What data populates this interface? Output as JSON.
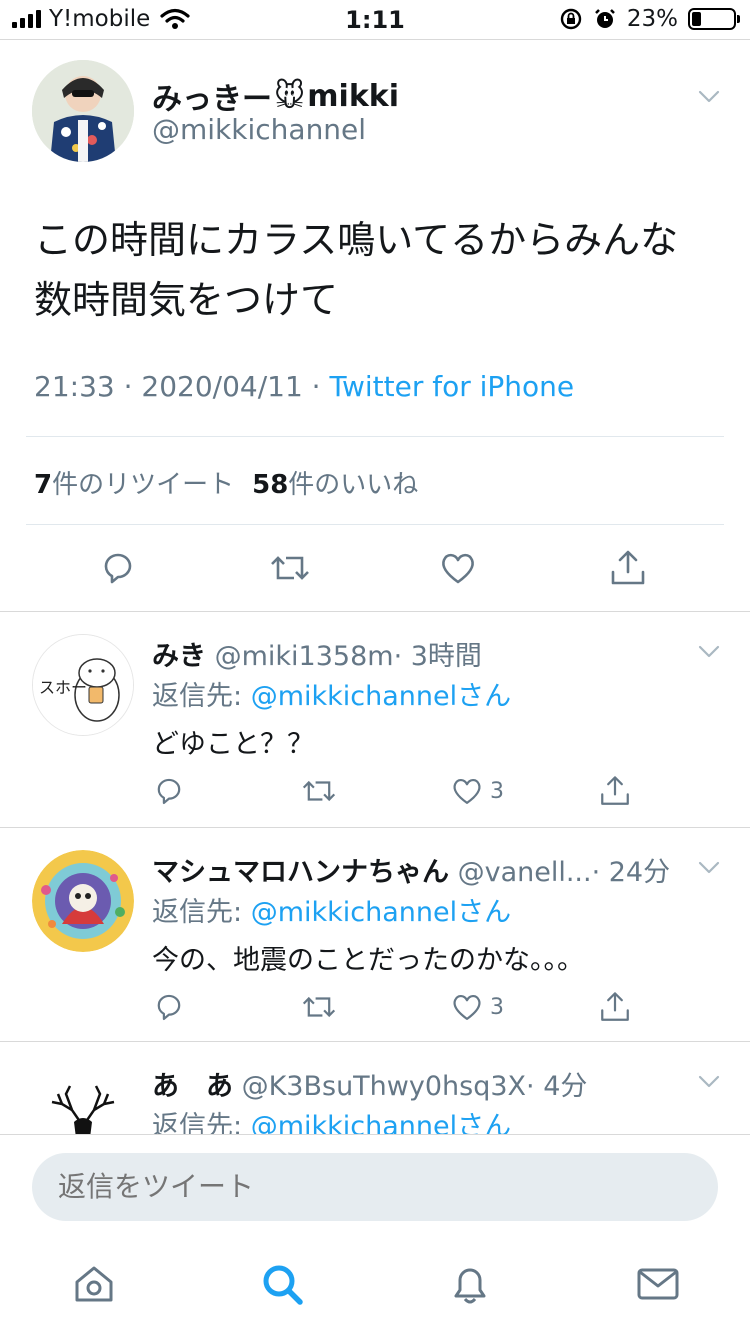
{
  "status_bar": {
    "carrier": "Y!mobile",
    "time": "1:11",
    "battery_percent_text": "23%",
    "battery_level": 0.23
  },
  "main_tweet": {
    "display_name": "みっきー",
    "name_emoji": "🐭",
    "name_suffix": "mikki",
    "handle": "@mikkichannel",
    "text": "この時間にカラス鳴いてるからみんな数時間気をつけて",
    "timestamp": "21:33 · 2020/04/11 · ",
    "source": "Twitter for iPhone",
    "retweet_count": "7",
    "retweet_label": "件のリツイート",
    "like_count": "58",
    "like_label": "件のいいね"
  },
  "replies": [
    {
      "name": "みき",
      "handle": "@miki1358m",
      "time": "· 3時間",
      "replying_prefix": "返信先: ",
      "replying_to": "@mikkichannelさん",
      "text": "どゆこと？？",
      "likes": "3"
    },
    {
      "name": "マシュマロハンナちゃん",
      "handle": "@vanell...",
      "time": "· 24分",
      "replying_prefix": "返信先: ",
      "replying_to": "@mikkichannelさん",
      "text": "今の、地震のことだったのかな。。。",
      "likes": "3"
    },
    {
      "name": "あ　あ",
      "handle": "@K3BsuThwy0hsq3X",
      "time": "· 4分",
      "replying_prefix": "返信先: ",
      "replying_to": "@mikkichannelさん"
    }
  ],
  "compose": {
    "placeholder": "返信をツイート"
  },
  "tabs": [
    "home-icon",
    "search-icon",
    "bell-icon",
    "mail-icon"
  ],
  "colors": {
    "accent": "#1da1f2",
    "secondary_text": "#657786",
    "divider": "#d9d9d9"
  }
}
